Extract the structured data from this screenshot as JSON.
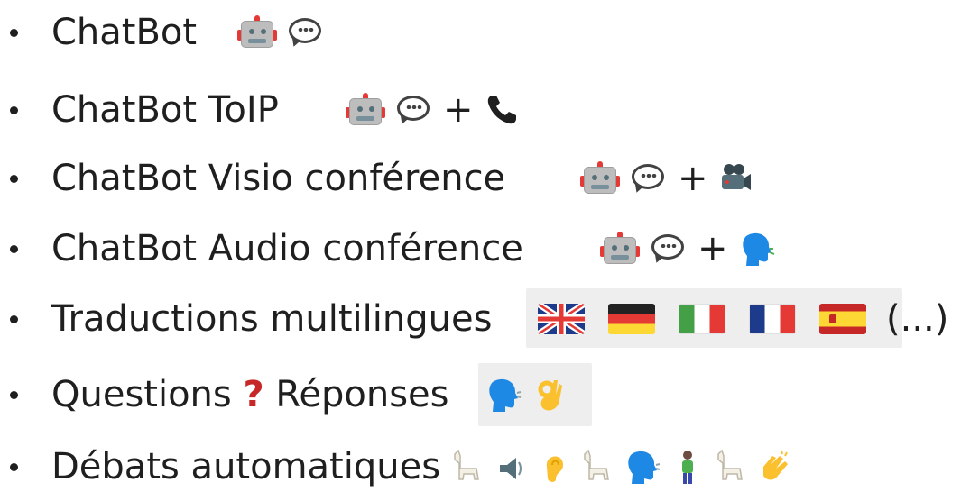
{
  "items": [
    {
      "label": "ChatBot",
      "icons": [
        "robot-icon",
        "speech-bubble-icon"
      ]
    },
    {
      "label": "ChatBot ToIP",
      "icons": [
        "robot-icon",
        "speech-bubble-icon",
        "plus-sign",
        "telephone-icon"
      ],
      "plus": "+"
    },
    {
      "label": "ChatBot Visio conférence",
      "icons": [
        "robot-icon",
        "speech-bubble-icon",
        "plus-sign",
        "movie-camera-icon"
      ],
      "plus": "+"
    },
    {
      "label": "ChatBot Audio conférence",
      "icons": [
        "robot-icon",
        "speech-bubble-icon",
        "plus-sign",
        "speaking-head-icon"
      ],
      "plus": "+"
    },
    {
      "label": "Traductions multilingues",
      "icons": [
        "flag-uk-icon",
        "flag-germany-icon",
        "flag-italy-icon",
        "flag-france-icon",
        "flag-spain-icon"
      ],
      "suffix": "(...)"
    },
    {
      "label_part1": "Questions",
      "label_mark": "?",
      "label_part2": "Réponses",
      "icons": [
        "speaking-head-icon",
        "ok-hand-icon"
      ]
    },
    {
      "label": "Débats automatiques",
      "icons": [
        "llama-icon",
        "speaker-icon",
        "ear-icon",
        "llama-icon",
        "speaking-head-icon",
        "person-standing-icon",
        "llama-icon",
        "clapping-hands-icon"
      ]
    }
  ],
  "colors": {
    "text": "#1f1f1f",
    "question_mark": "#c62828",
    "highlight_bg": "#eeeeee"
  }
}
